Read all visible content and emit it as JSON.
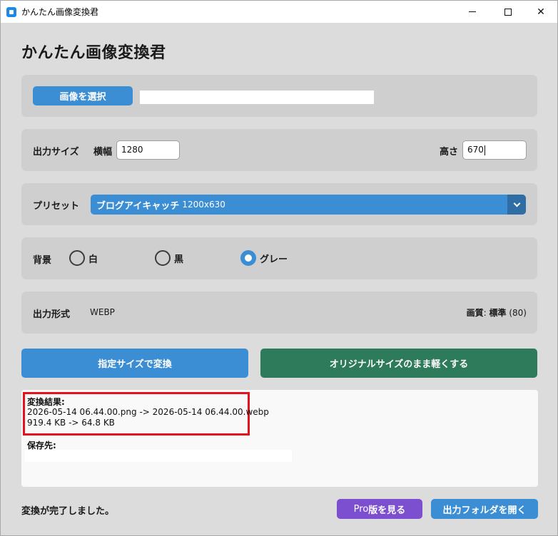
{
  "window": {
    "title": "かんたん画像変換君",
    "controls": {
      "minimize": "—",
      "maximize": "☐",
      "close": "✕"
    }
  },
  "app": {
    "heading": "かんたん画像変換君"
  },
  "file": {
    "select_label": "画像を選択",
    "path": ""
  },
  "size": {
    "label": "出力サイズ",
    "width_label": "横幅",
    "width_value": "1280",
    "height_label": "高さ",
    "height_value": "670"
  },
  "preset": {
    "label": "プリセット",
    "selected_main": "ブログアイキャッチ",
    "selected_sub": "1200x630"
  },
  "background": {
    "label": "背景",
    "options": [
      {
        "label": "白",
        "selected": false
      },
      {
        "label": "黒",
        "selected": false
      },
      {
        "label": "グレー",
        "selected": true
      }
    ]
  },
  "format": {
    "label": "出力形式",
    "value": "WEBP",
    "quality_label": "画質",
    "quality_value": "標準",
    "quality_number": "(80)"
  },
  "actions": {
    "convert_label": "指定サイズで変換",
    "original_label": "オリジナルサイズのまま軽くする"
  },
  "result": {
    "heading": "変換結果:",
    "file_line": "2026-05-14 06.44.00.png -> 2026-05-14 06.44.00.webp",
    "size_line": "919.4 KB -> 64.8 KB",
    "save_heading": "保存先:",
    "save_path": ""
  },
  "footer": {
    "status": "変換が完了しました。",
    "pro_prefix": "Pro",
    "pro_suffix": "版を見る",
    "folder_label": "出力フォルダを開く"
  },
  "colors": {
    "accent": "#3b8ed4",
    "green": "#2e7b5b",
    "pro": "#7b4fd0",
    "highlight": "#e3121c"
  }
}
